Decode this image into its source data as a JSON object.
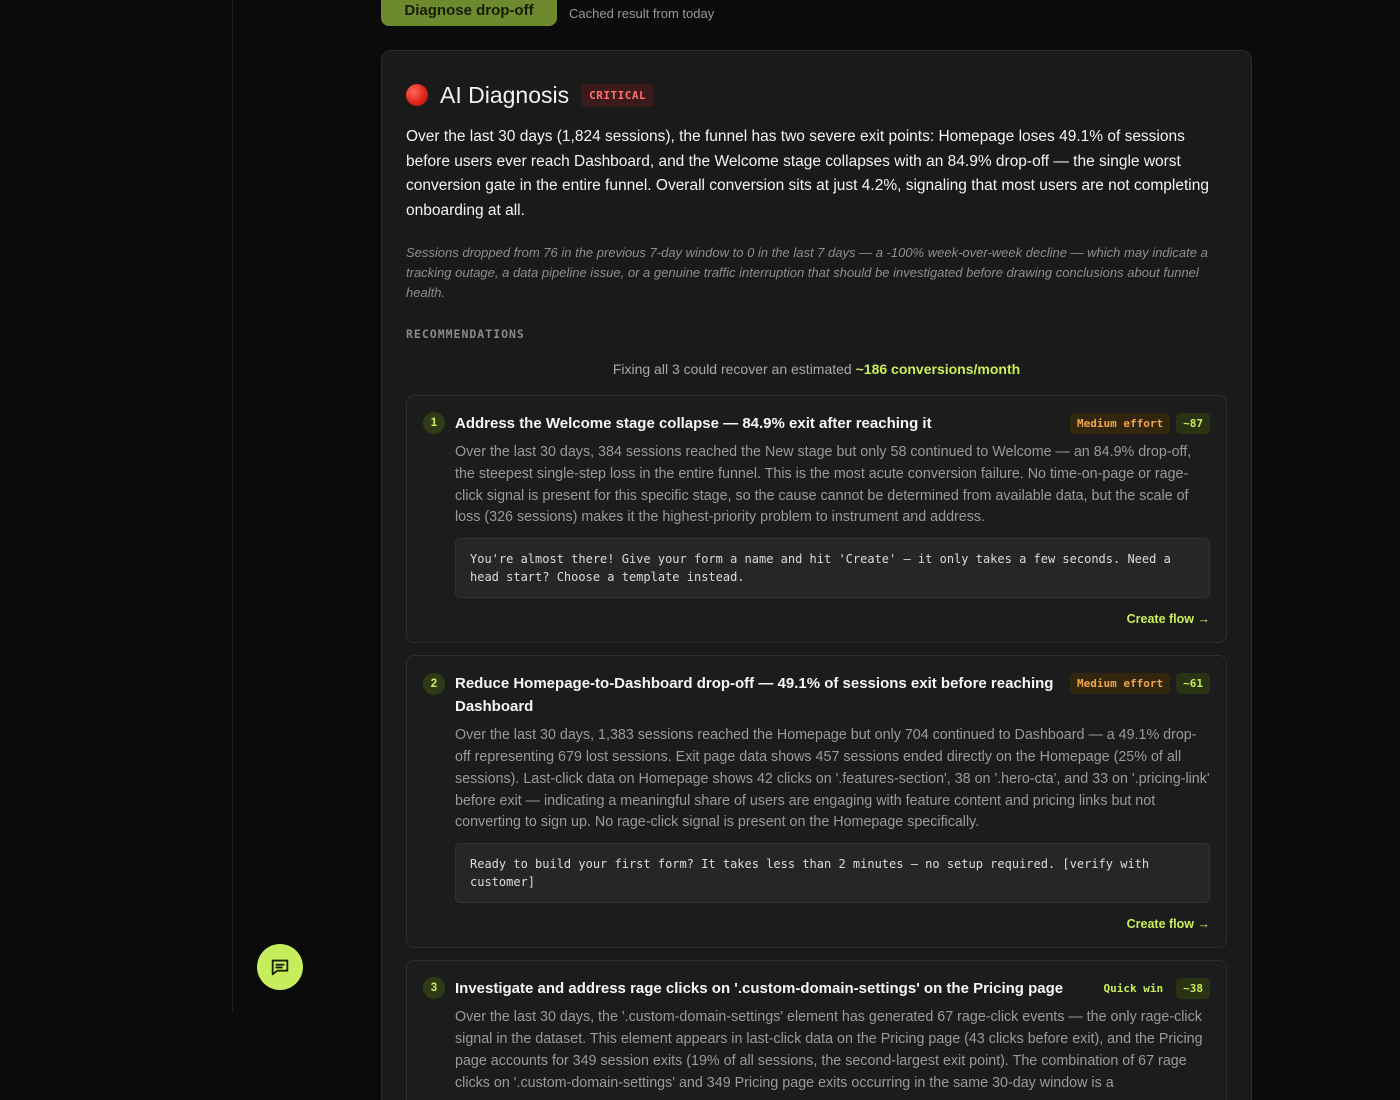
{
  "top": {
    "diagnose_label": "Diagnose drop-off",
    "cache_note": "Cached result from today"
  },
  "diagnosis": {
    "title": "AI Diagnosis",
    "severity": "CRITICAL",
    "summary": "Over the last 30 days (1,824 sessions), the funnel has two severe exit points: Homepage loses 49.1% of sessions before users ever reach Dashboard, and the Welcome stage collapses with an 84.9% drop-off — the single worst conversion gate in the entire funnel. Overall conversion sits at just 4.2%, signaling that most users are not completing onboarding at all.",
    "trend_note": "Sessions dropped from 76 in the previous 7-day window to 0 in the last 7 days — a -100% week-over-week decline — which may indicate a tracking outage, a data pipeline issue, or a genuine traffic interruption that should be investigated before drawing conclusions about funnel health."
  },
  "recommendations": {
    "heading": "RECOMMENDATIONS",
    "recover_prefix": "Fixing all 3 could recover an estimated",
    "recover_value": "~186 conversions/month",
    "items": [
      {
        "number": "1",
        "title": "Address the Welcome stage collapse — 84.9% exit after reaching it",
        "effort": "Medium effort",
        "impact": "~87",
        "body": "Over the last 30 days, 384 sessions reached the New stage but only 58 continued to Welcome — an 84.9% drop-off, the steepest single-step loss in the entire funnel. This is the most acute conversion failure. No time-on-page or rage-click signal is present for this specific stage, so the cause cannot be determined from available data, but the scale of loss (326 sessions) makes it the highest-priority problem to instrument and address.",
        "copy": "You're almost there! Give your form a name and hit 'Create' — it only takes a few seconds. Need a head start? Choose a template instead.",
        "action": "Create flow →"
      },
      {
        "number": "2",
        "title": "Reduce Homepage-to-Dashboard drop-off — 49.1% of sessions exit before reaching Dashboard",
        "effort": "Medium effort",
        "impact": "~61",
        "body": "Over the last 30 days, 1,383 sessions reached the Homepage but only 704 continued to Dashboard — a 49.1% drop-off representing 679 lost sessions. Exit page data shows 457 sessions ended directly on the Homepage (25% of all sessions). Last-click data on Homepage shows 42 clicks on '.features-section', 38 on '.hero-cta', and 33 on '.pricing-link' before exit — indicating a meaningful share of users are engaging with feature content and pricing links but not converting to sign up. No rage-click signal is present on the Homepage specifically.",
        "copy": "Ready to build your first form? It takes less than 2 minutes — no setup required. [verify with customer]",
        "action": "Create flow →"
      },
      {
        "number": "3",
        "title": "Investigate and address rage clicks on '.custom-domain-settings' on the Pricing page",
        "effort": "Quick win",
        "impact": "~38",
        "body": "Over the last 30 days, the '.custom-domain-settings' element has generated 67 rage-click events — the only rage-click signal in the dataset. This element appears in last-click data on the Pricing page (43 clicks before exit), and the Pricing page accounts for 349 session exits (19% of all sessions, the second-largest exit point). The combination of 67 rage clicks on '.custom-domain-settings' and 349 Pricing page exits occurring in the same 30-day window is a",
        "copy": "",
        "action": ""
      }
    ]
  }
}
